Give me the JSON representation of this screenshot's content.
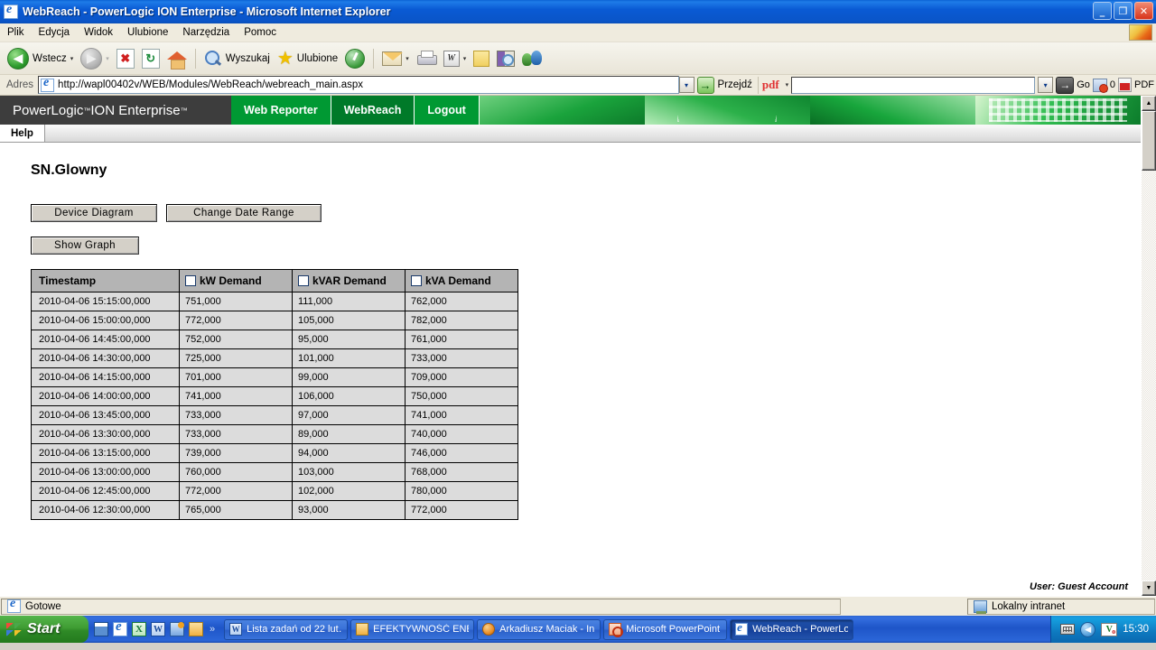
{
  "window": {
    "title": "WebReach - PowerLogic ION Enterprise - Microsoft Internet Explorer",
    "minimize": "_",
    "restore": "❐",
    "close": "✕"
  },
  "menu": {
    "items": [
      "Plik",
      "Edycja",
      "Widok",
      "Ulubione",
      "Narzędzia",
      "Pomoc"
    ]
  },
  "toolbar": {
    "back_label": "Wstecz",
    "back_glyph": "◀",
    "forward_glyph": "▶",
    "stop_glyph": "✖",
    "refresh_glyph": "↻",
    "search_label": "Wyszukaj",
    "favorites_label": "Ulubione",
    "star_glyph": "★",
    "word_glyph": "W",
    "caret_glyph": "▾"
  },
  "address": {
    "label": "Adres",
    "url": "http://wapl00402v/WEB/Modules/WebReach/webreach_main.aspx",
    "go_label": "Przejdź",
    "go_glyph": "→",
    "dropdown_glyph": "▾"
  },
  "pdf_toolbar": {
    "logo": "pdf",
    "search_value": "",
    "go_label": "Go",
    "go_glyph": "→",
    "count": "0",
    "pdf_label": "PDF",
    "caret_glyph": "▾",
    "dropdown_glyph": "▾"
  },
  "app": {
    "brand": "PowerLogic",
    "brand_tm1": "™",
    "brand_mid": " ION Enterprise",
    "brand_tm2": "™",
    "tabs": [
      {
        "label": "Web Reporter",
        "active": false
      },
      {
        "label": "WebReach",
        "active": true
      },
      {
        "label": "Logout",
        "active": false
      }
    ],
    "subtab": "Help",
    "accent_color": "#009933",
    "accent_active_color": "#007a29"
  },
  "main": {
    "page_title": "SN.Glowny",
    "buttons": {
      "device_diagram": "Device Diagram",
      "change_date_range": "Change Date Range",
      "show_graph": "Show Graph"
    },
    "table": {
      "headers": [
        "Timestamp",
        "kW Demand",
        "kVAR Demand",
        "kVA Demand"
      ],
      "checkbox_checked": [
        false,
        false,
        false
      ],
      "rows": [
        [
          "2010-04-06 15:15:00,000",
          "751,000",
          "111,000",
          "762,000"
        ],
        [
          "2010-04-06 15:00:00,000",
          "772,000",
          "105,000",
          "782,000"
        ],
        [
          "2010-04-06 14:45:00,000",
          "752,000",
          "95,000",
          "761,000"
        ],
        [
          "2010-04-06 14:30:00,000",
          "725,000",
          "101,000",
          "733,000"
        ],
        [
          "2010-04-06 14:15:00,000",
          "701,000",
          "99,000",
          "709,000"
        ],
        [
          "2010-04-06 14:00:00,000",
          "741,000",
          "106,000",
          "750,000"
        ],
        [
          "2010-04-06 13:45:00,000",
          "733,000",
          "97,000",
          "741,000"
        ],
        [
          "2010-04-06 13:30:00,000",
          "733,000",
          "89,000",
          "740,000"
        ],
        [
          "2010-04-06 13:15:00,000",
          "739,000",
          "94,000",
          "746,000"
        ],
        [
          "2010-04-06 13:00:00,000",
          "760,000",
          "103,000",
          "768,000"
        ],
        [
          "2010-04-06 12:45:00,000",
          "772,000",
          "102,000",
          "780,000"
        ],
        [
          "2010-04-06 12:30:00,000",
          "765,000",
          "93,000",
          "772,000"
        ]
      ]
    },
    "user_line": "User: Guest Account"
  },
  "scrollbar": {
    "up_glyph": "▲",
    "down_glyph": "▼"
  },
  "status": {
    "text": "Gotowe",
    "zone": "Lokalny intranet"
  },
  "taskbar": {
    "start_label": "Start",
    "quicklaunch_more": "»",
    "tasks": [
      {
        "label": "Lista zadań od 22 lut…",
        "icon": "word-icon",
        "active": false
      },
      {
        "label": "EFEKTYWNOŚĆ ENER…",
        "icon": "folder-icon",
        "active": false
      },
      {
        "label": "Arkadiusz Maciak - In…",
        "icon": "globe-icon",
        "active": false
      },
      {
        "label": "Microsoft PowerPoint …",
        "icon": "powerpoint-icon",
        "active": false
      },
      {
        "label": "WebReach - PowerLo…",
        "icon": "ie-icon",
        "active": true
      }
    ],
    "tray": {
      "arrow_glyph": "◀",
      "lang_icon": "V",
      "clock": "15:30"
    }
  }
}
